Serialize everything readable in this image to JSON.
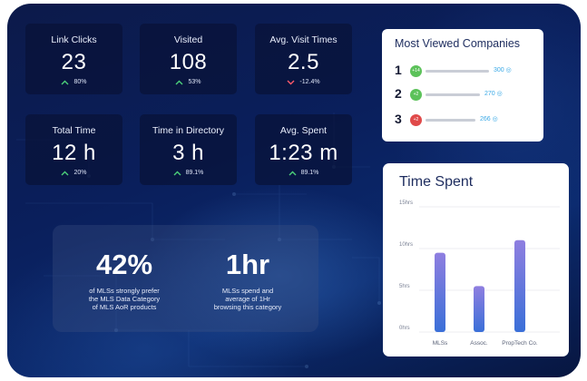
{
  "stats": [
    {
      "label": "Link Clicks",
      "value": "23",
      "change": "80%",
      "direction": "up"
    },
    {
      "label": "Visited",
      "value": "108",
      "change": "53%",
      "direction": "up"
    },
    {
      "label": "Avg. Visit Times",
      "value": "2.5",
      "change": "-12.4%",
      "direction": "down"
    },
    {
      "label": "Total Time",
      "value": "12 h",
      "change": "20%",
      "direction": "up"
    },
    {
      "label": "Time in Directory",
      "value": "3 h",
      "change": "89.1%",
      "direction": "up"
    },
    {
      "label": "Avg. Spent",
      "value": "1:23 m",
      "change": "89.1%",
      "direction": "up"
    }
  ],
  "insights": [
    {
      "number": "42%",
      "lines": [
        "of MLSs strongly prefer",
        "the MLS Data Category",
        "of MLS AoR products"
      ]
    },
    {
      "number": "1hr",
      "lines": [
        "MLSs spend and",
        "average of 1Hr",
        "browsing this category"
      ]
    }
  ],
  "companies": {
    "title": "Most Viewed Companies",
    "items": [
      {
        "rank": "1",
        "badge": "+14",
        "badge_color": "#5cc25a",
        "value": "300",
        "fraction": 1.0
      },
      {
        "rank": "2",
        "badge": "+2",
        "badge_color": "#5cc25a",
        "value": "270",
        "fraction": 0.85
      },
      {
        "rank": "3",
        "badge": "+2",
        "badge_color": "#e04a4a",
        "value": "266",
        "fraction": 0.78
      }
    ]
  },
  "colors": {
    "up_arrow": "#4cd07a",
    "down_arrow": "#ff5a6a",
    "bar_purple": "#8f7fe0",
    "bar_blue": "#3a6fd8"
  },
  "chart_data": {
    "type": "bar",
    "title": "Time Spent",
    "categories": [
      "MLSs",
      "Assoc.",
      "PropTech Co."
    ],
    "values": [
      9.5,
      5.5,
      11
    ],
    "ylim": [
      0,
      15
    ],
    "yticks": [
      "0hrs",
      "5hrs",
      "10hrs",
      "15hrs"
    ],
    "ytick_values": [
      0,
      5,
      10,
      15
    ],
    "grid": true
  }
}
